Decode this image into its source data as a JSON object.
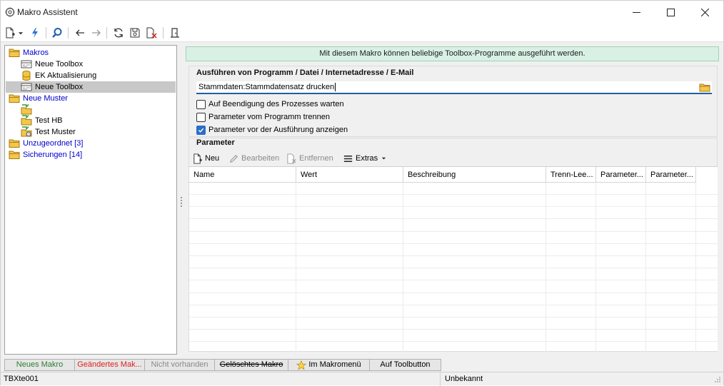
{
  "window": {
    "title": "Makro Assistent"
  },
  "tree": {
    "items": [
      {
        "label": "Makros",
        "icon": "folder-icon",
        "blue": true,
        "selected": false
      },
      {
        "label": "Neue Toolbox",
        "icon": "toolbox-icon",
        "blue": false,
        "selected": false
      },
      {
        "label": "EK Aktualisierung",
        "icon": "database-icon",
        "blue": false,
        "selected": false
      },
      {
        "label": "Neue Toolbox",
        "icon": "toolbox-icon",
        "blue": false,
        "selected": true
      },
      {
        "label": "Neue Muster",
        "icon": "folder-icon",
        "blue": true,
        "selected": false
      },
      {
        "label": "",
        "icon": "folder-arrow-icon",
        "blue": false,
        "selected": false
      },
      {
        "label": "Test HB",
        "icon": "folder-arrow-icon",
        "blue": false,
        "selected": false
      },
      {
        "label": "Test Muster",
        "icon": "folder-arrow-gear-icon",
        "blue": false,
        "selected": false
      },
      {
        "label": "Unzugeordnet [3]",
        "icon": "folder-icon",
        "blue": true,
        "selected": false
      },
      {
        "label": "Sicherungen [14]",
        "icon": "folder-icon",
        "blue": true,
        "selected": false
      }
    ]
  },
  "info_banner": "Mit diesem Makro können beliebige Toolbox-Programme ausgeführt werden.",
  "execute_group": {
    "title": "Ausführen von Programm / Datei / Internetadresse / E-Mail",
    "path_value": "Stammdaten:Stammdatensatz drucken",
    "checkboxes": [
      {
        "label": "Auf Beendigung des Prozesses warten",
        "checked": false
      },
      {
        "label": "Parameter vom Programm trennen",
        "checked": false
      },
      {
        "label": "Parameter vor der Ausführung anzeigen",
        "checked": true
      }
    ]
  },
  "params_group": {
    "title": "Parameter",
    "toolbar": {
      "new_label": "Neu",
      "edit_label": "Bearbeiten",
      "remove_label": "Entfernen",
      "extras_label": "Extras"
    },
    "columns": [
      "Name",
      "Wert",
      "Beschreibung",
      "Trenn-Lee...",
      "Parameter...",
      "Parameter..."
    ]
  },
  "legend": {
    "new_macro": "Neues Makro",
    "changed_macro": "Geändertes Mak...",
    "not_present": "Nicht vorhanden",
    "deleted_macro": "Gelöschtes Makro",
    "in_menu": "Im Makromenü",
    "on_toolbutton": "Auf Toolbutton"
  },
  "colors": {
    "new_macro": "#2e7d32",
    "changed_macro": "#e02020",
    "not_present": "#8a8a8a",
    "info_bg": "#d8f1e4",
    "accent": "#2b6fc8"
  },
  "status": {
    "left": "TBXte001",
    "right": "Unbekannt"
  }
}
